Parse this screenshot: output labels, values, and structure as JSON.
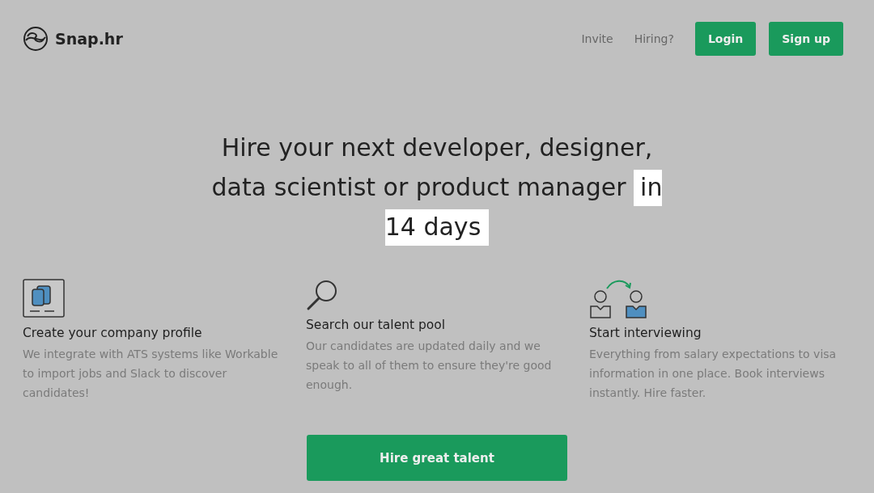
{
  "brand": {
    "name": "Snap.hr"
  },
  "nav": {
    "links": [
      "Invite",
      "Hiring?"
    ],
    "buttons": [
      "Login",
      "Sign up"
    ]
  },
  "hero": {
    "headline": "Hire your next developer, designer, data scientist or product manager",
    "highlight": "in 14 days"
  },
  "features": [
    {
      "kind": "profile",
      "title": "Create your company profile",
      "text": "We integrate with ATS systems like Workable to import jobs and Slack to discover candidates!"
    },
    {
      "kind": "search",
      "title": "Search our talent pool",
      "text": "Our candidates are updated daily and we speak to all of them to ensure they're good enough."
    },
    {
      "kind": "interview",
      "title": "Start interviewing",
      "text": "Everything from salary expectations to visa information in one place. Book interviews instantly. Hire faster."
    }
  ],
  "cta": {
    "label": "Hire great talent"
  }
}
